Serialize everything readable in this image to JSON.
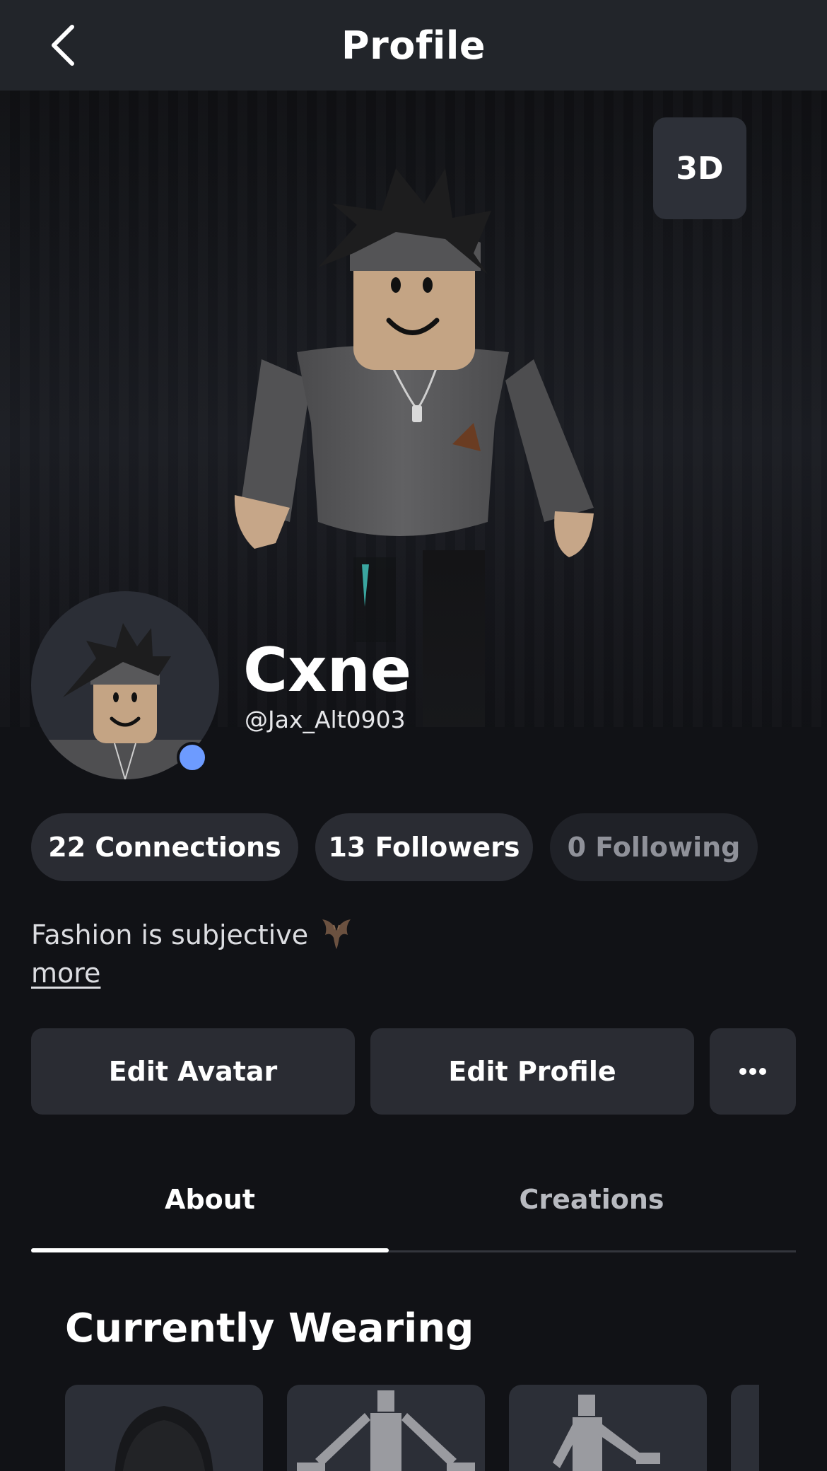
{
  "header": {
    "title": "Profile",
    "back_icon": "chevron-left-icon"
  },
  "hero": {
    "view_toggle_label": "3D"
  },
  "profile": {
    "display_name": "Cxne",
    "username": "@Jax_Alt0903",
    "presence_color": "#6d9bff"
  },
  "stats": [
    {
      "label": "22 Connections"
    },
    {
      "label": "13 Followers"
    },
    {
      "label": "0 Following"
    }
  ],
  "bio": {
    "text": "Fashion is subjective",
    "emoji_icon": "bat-icon",
    "more_label": "more"
  },
  "actions": {
    "edit_avatar": "Edit Avatar",
    "edit_profile": "Edit Profile",
    "more_icon": "ellipsis-icon"
  },
  "tabs": [
    {
      "label": "About",
      "active": true
    },
    {
      "label": "Creations",
      "active": false
    }
  ],
  "wearing": {
    "title": "Currently Wearing",
    "items": [
      {
        "icon": "hair-accessory-icon"
      },
      {
        "icon": "animation-pose-icon"
      },
      {
        "icon": "animation-walk-icon"
      },
      {
        "icon": "item-icon"
      }
    ]
  }
}
